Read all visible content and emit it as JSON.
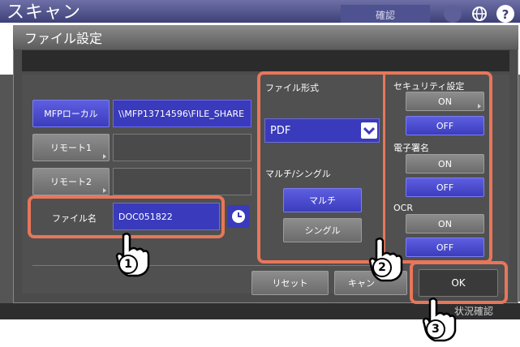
{
  "header": {
    "title": "スキャン",
    "confirm_tab": "確認"
  },
  "dialog": {
    "title": "ファイル設定"
  },
  "destination": {
    "mfp_local_label": "MFPローカル",
    "mfp_local_path": "\\\\MFP13714596\\FILE_SHARE",
    "remote1_label": "リモート1",
    "remote2_label": "リモート2",
    "file_name_label": "ファイル名",
    "file_name_value": "DOC051822"
  },
  "format": {
    "section_label": "ファイル形式",
    "selected": "PDF",
    "multi_single_label": "マルチ/シングル",
    "multi_label": "マルチ",
    "single_label": "シングル"
  },
  "security": {
    "section_label": "セキュリティ設定",
    "on": "ON",
    "off": "OFF"
  },
  "signature": {
    "section_label": "電子署名",
    "on": "ON",
    "off": "OFF"
  },
  "ocr": {
    "section_label": "OCR",
    "on": "ON",
    "off": "OFF"
  },
  "footer": {
    "reset_label": "リセット",
    "cancel_label": "キャン",
    "ok_label": "OK",
    "job_status": "状況確認"
  },
  "steps": [
    "1",
    "2",
    "3"
  ],
  "colors": {
    "annotation": "#e8765a",
    "blue_button": "#4546c9",
    "top_bar": "#5a5c94"
  },
  "icons": [
    "clock-icon",
    "chevron-down-icon",
    "globe-icon",
    "help-icon",
    "pointing-hand-icon"
  ]
}
